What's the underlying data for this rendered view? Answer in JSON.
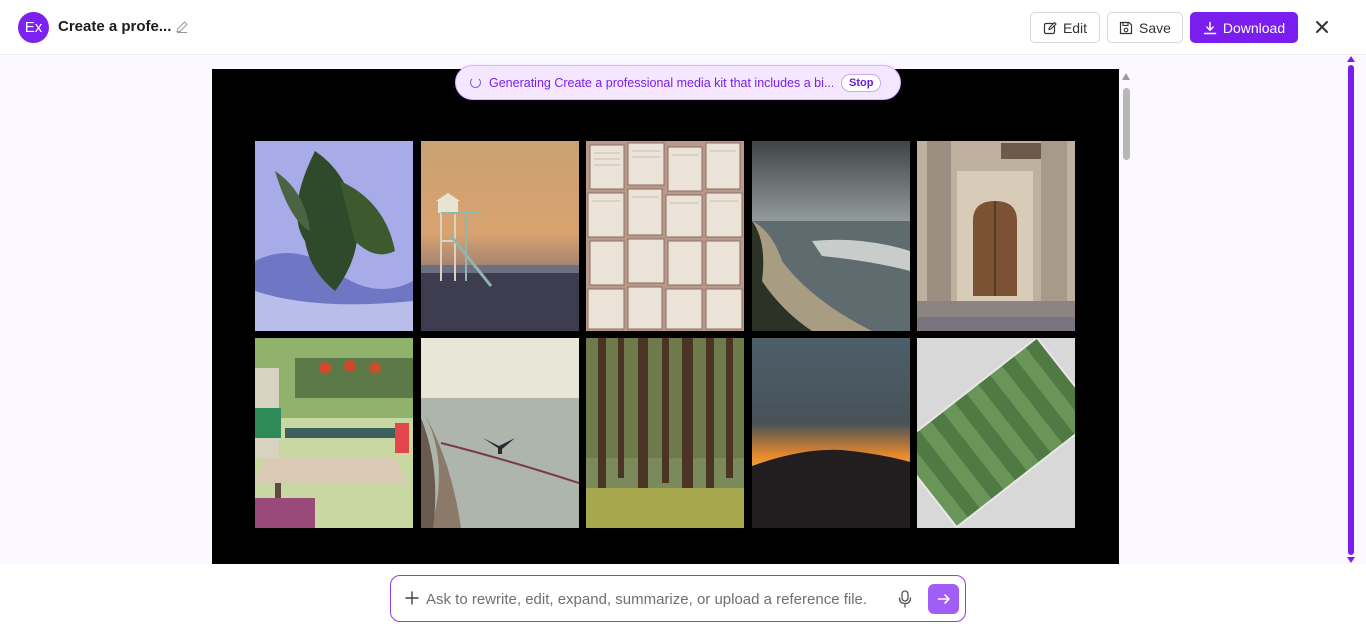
{
  "header": {
    "logo_text": "Ex",
    "title": "Create a profe...",
    "edit_label": "Edit",
    "save_label": "Save",
    "download_label": "Download"
  },
  "generation": {
    "status_text": "Generating Create a professional media kit that includes a bi...",
    "stop_label": "Stop"
  },
  "gallery": {
    "tiles": [
      {
        "name": "tree-reflection-photo",
        "alt": "Tree reflection in water"
      },
      {
        "name": "lifeguard-tower-photo",
        "alt": "Lifeguard tower at sunset"
      },
      {
        "name": "open-books-photo",
        "alt": "Open book pages"
      },
      {
        "name": "coastline-photo",
        "alt": "Rocky coastline with waves"
      },
      {
        "name": "wooden-door-photo",
        "alt": "Old wooden door"
      },
      {
        "name": "cafe-table-photo",
        "alt": "Cafe table with plants"
      },
      {
        "name": "bird-on-boat-photo",
        "alt": "Bird perched on a boat"
      },
      {
        "name": "forest-photo",
        "alt": "Pine forest"
      },
      {
        "name": "sunset-hill-photo",
        "alt": "Sunset over a hill"
      },
      {
        "name": "aerial-field-photo",
        "alt": "Aerial view of a sports field"
      }
    ]
  },
  "prompt": {
    "placeholder": "Ask to rewrite, edit, expand, summarize, or upload a reference file."
  },
  "colors": {
    "accent": "#7a1ef0",
    "accent_light": "#f4e7ff",
    "canvas_bg": "#000000"
  },
  "icons": [
    "pencil-icon",
    "edit-icon",
    "save-icon",
    "download-icon",
    "close-icon",
    "spinner-icon",
    "plus-icon",
    "mic-icon",
    "arrow-right-icon"
  ]
}
